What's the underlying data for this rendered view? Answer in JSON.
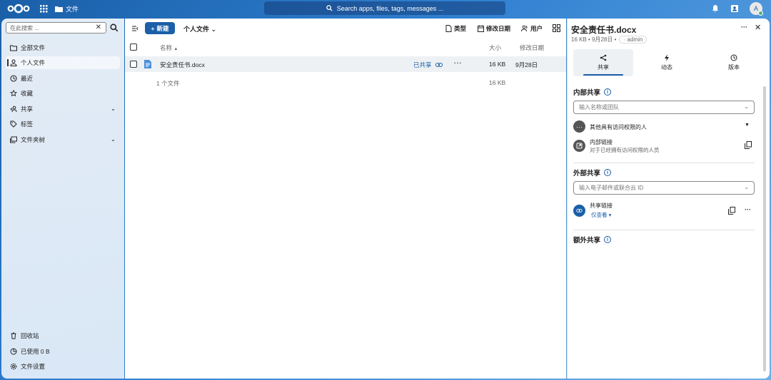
{
  "topbar": {
    "app_name": "文件",
    "search_placeholder": "Search apps, files, tags, messages ...",
    "avatar_initial": "A"
  },
  "sidebar": {
    "search_placeholder": "在此搜索 ...",
    "items": [
      {
        "label": "全部文件",
        "icon": "folder-icon"
      },
      {
        "label": "个人文件",
        "icon": "user-icon",
        "active": true
      },
      {
        "label": "最近",
        "icon": "history-icon"
      },
      {
        "label": "收藏",
        "icon": "star-icon"
      },
      {
        "label": "共享",
        "icon": "share-icon",
        "expandable": true
      },
      {
        "label": "标签",
        "icon": "tag-icon"
      },
      {
        "label": "文件夹树",
        "icon": "folder-tree-icon",
        "expandable": true
      }
    ],
    "footer": [
      {
        "label": "回收站",
        "icon": "trash-icon"
      },
      {
        "label": "已使用 0 B",
        "icon": "pie-chart-icon"
      },
      {
        "label": "文件设置",
        "icon": "settings-icon"
      }
    ]
  },
  "main": {
    "new_label": "新建",
    "breadcrumb": "个人文件",
    "filters": [
      {
        "label": "类型",
        "icon": "file-type-icon"
      },
      {
        "label": "修改日期",
        "icon": "calendar-icon"
      },
      {
        "label": "用户",
        "icon": "users-icon"
      }
    ],
    "columns": {
      "name": "名称",
      "sort_indicator": "▲",
      "size": "大小",
      "modified": "修改日期"
    },
    "files": [
      {
        "name": "安全责任书.docx",
        "share_status": "已共享",
        "size": "16 KB",
        "modified": "9月28日"
      }
    ],
    "summary": {
      "count": "1 个文件",
      "total_size": "16 KB"
    }
  },
  "panel": {
    "title": "安全责任书.docx",
    "meta": "16 KB • 9月28日 •",
    "tag": "admin",
    "tabs": [
      {
        "label": "共享",
        "icon": "share-icon",
        "active": true
      },
      {
        "label": "动态",
        "icon": "activity-icon"
      },
      {
        "label": "版本",
        "icon": "history-icon"
      }
    ],
    "internal": {
      "title": "内部共享",
      "input_placeholder": "输入名称或团队",
      "others_label": "其他具有访问权限的人",
      "link_title": "内部链接",
      "link_desc": "对于已经拥有访问权限的人员"
    },
    "external": {
      "title": "外部共享",
      "input_placeholder": "输入电子邮件或联合云 ID",
      "link_title": "共享链接",
      "link_perm": "仅查看"
    },
    "additional": {
      "title": "额外共享"
    }
  },
  "colors": {
    "brand": "#1a5fa8",
    "accent": "#1a5fa8",
    "status_online": "#49b382"
  }
}
